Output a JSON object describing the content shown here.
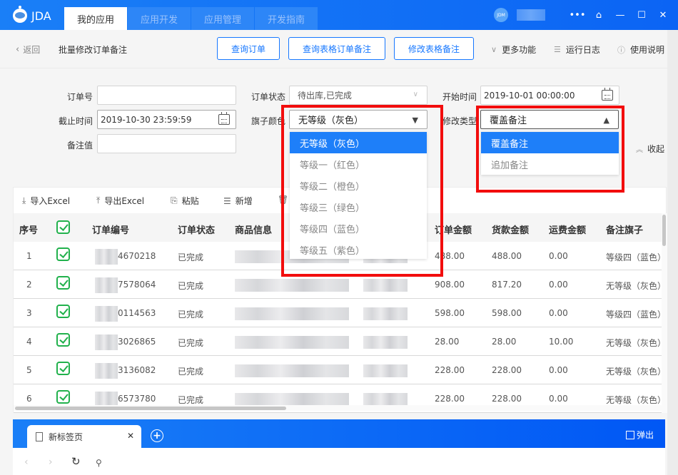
{
  "app": {
    "logo": "JDA",
    "tabs": [
      "我的应用",
      "应用开发",
      "应用管理",
      "开发指南"
    ],
    "active_tab": 0,
    "avatar": "JDM",
    "window_icons": [
      "more-icon",
      "home-icon",
      "minimize-icon",
      "maximize-icon",
      "close-icon"
    ]
  },
  "subbar": {
    "back_label": "返回",
    "title": "批量修改订单备注",
    "buttons": [
      "查询订单",
      "查询表格订单备注",
      "修改表格备注"
    ],
    "links": [
      {
        "icon": "chevron-down-icon",
        "label": "更多功能"
      },
      {
        "icon": "log-icon",
        "label": "运行日志"
      },
      {
        "icon": "info-icon",
        "label": "使用说明"
      }
    ]
  },
  "filter": {
    "order_no": {
      "label": "订单号",
      "value": ""
    },
    "order_status": {
      "label": "订单状态",
      "value": "待出库,已完成"
    },
    "start_time": {
      "label": "开始时间",
      "value": "2019-10-01 00:00:00"
    },
    "end_time": {
      "label": "截止时间",
      "value": "2019-10-30 23:59:59"
    },
    "flag_color": {
      "label": "旗子颜色",
      "value": "无等级（灰色）",
      "options": [
        "无等级（灰色）",
        "等级一（红色）",
        "等级二（橙色）",
        "等级三（绿色）",
        "等级四（蓝色）",
        "等级五（紫色）"
      ],
      "selected_index": 0
    },
    "modify_type": {
      "label": "修改类型",
      "value": "覆盖备注",
      "options": [
        "覆盖备注",
        "追加备注"
      ],
      "selected_index": 0
    },
    "remark_value": {
      "label": "备注值",
      "value": ""
    },
    "collapse_label": "收起"
  },
  "table": {
    "toolbar": [
      "导入Excel",
      "导出Excel",
      "粘贴",
      "新增"
    ],
    "columns": [
      "序号",
      "",
      "订单编号",
      "订单状态",
      "商品信息",
      "",
      "订单金额",
      "货款金额",
      "运费金额",
      "备注旗子"
    ],
    "rows": [
      {
        "index": "1",
        "checked": true,
        "order_no_suffix": "4670218",
        "status": "已完成",
        "order_amount": "488.00",
        "goods_amount": "488.00",
        "freight": "0.00",
        "flag": "等级四（蓝色）"
      },
      {
        "index": "2",
        "checked": true,
        "order_no_suffix": "7578064",
        "status": "已完成",
        "order_amount": "908.00",
        "goods_amount": "817.20",
        "freight": "0.00",
        "flag": "无等级（灰色）"
      },
      {
        "index": "3",
        "checked": true,
        "order_no_suffix": "0114563",
        "status": "已完成",
        "order_amount": "598.00",
        "goods_amount": "598.00",
        "freight": "0.00",
        "flag": "等级四（蓝色）"
      },
      {
        "index": "4",
        "checked": true,
        "order_no_suffix": "3026865",
        "status": "已完成",
        "order_amount": "28.00",
        "goods_amount": "28.00",
        "freight": "10.00",
        "flag": "无等级（灰色）"
      },
      {
        "index": "5",
        "checked": true,
        "order_no_suffix": "3136082",
        "status": "已完成",
        "order_amount": "228.00",
        "goods_amount": "228.00",
        "freight": "0.00",
        "flag": "无等级（灰色）"
      },
      {
        "index": "6",
        "checked": true,
        "order_no_suffix": "6573780",
        "status": "已完成",
        "order_amount": "228.00",
        "goods_amount": "228.00",
        "freight": "0.00",
        "flag": "无等级（灰色）"
      }
    ]
  },
  "browser": {
    "tab_title": "新标签页",
    "popout_label": "弹出"
  },
  "colors": {
    "primary": "#1677ff",
    "titlebar": "#0b64f4",
    "highlight": "#1e7ff9",
    "check": "#21b14c",
    "annotation": "#f20d0d"
  }
}
